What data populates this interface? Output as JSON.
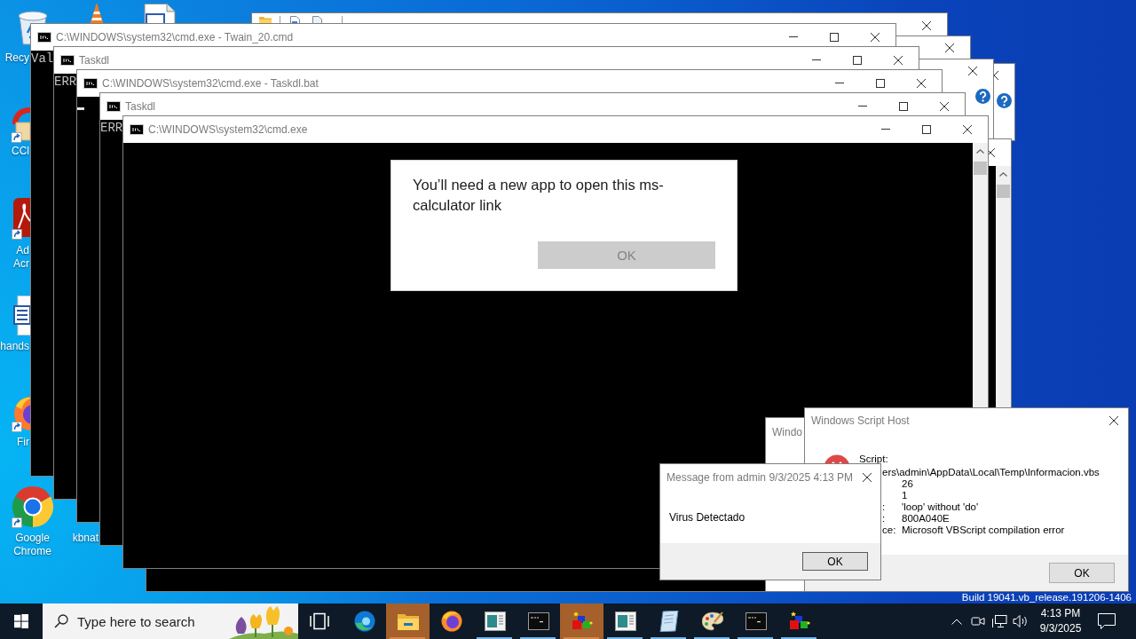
{
  "desktop": {
    "icons": [
      {
        "kind": "recycle_bin",
        "label": [
          "Recy"
        ]
      },
      {
        "kind": "cone"
      },
      {
        "kind": "document"
      },
      {
        "kind": "cleaner",
        "label": [
          "CCl"
        ]
      },
      {
        "kind": "pdf",
        "label": [
          "Ad",
          "Acr"
        ]
      },
      {
        "kind": "word_doc",
        "label": [
          "hands"
        ]
      },
      {
        "kind": "firefox",
        "label": [
          "Fir"
        ]
      },
      {
        "kind": "chrome",
        "label": [
          "Google",
          "Chrome"
        ]
      },
      {
        "label": [
          "kbnat"
        ]
      }
    ],
    "build_info": "Build 19041.vb_release.191206-1406"
  },
  "background_windows": [
    {
      "kind": "explorer"
    },
    {
      "kind": "window"
    },
    {
      "kind": "help_dialog"
    },
    {
      "kind": "help_dialog"
    },
    {
      "kind": "console"
    }
  ],
  "consoles": [
    {
      "title": "C:\\WINDOWS\\system32\\cmd.exe - Twain_20.cmd",
      "lines": [
        "Val"
      ],
      "cursor": false
    },
    {
      "title": "Taskdl",
      "lines": [
        "ERR"
      ],
      "cursor": false
    },
    {
      "title": "C:\\WINDOWS\\system32\\cmd.exe - Taskdl.bat",
      "cursor": true
    },
    {
      "title": "Taskdl",
      "lines": [
        "ERR"
      ],
      "cursor": false
    },
    {
      "title": "C:\\WINDOWS\\system32\\cmd.exe",
      "cursor": false
    }
  ],
  "app_prompt": {
    "message": "You’ll need a new app to open this ms-calculator link",
    "button": "OK",
    "disabled": true
  },
  "dialogs": [
    {
      "kind": "partial",
      "title": "Windo"
    },
    {
      "kind": "script_error",
      "title": "Windows Script Host",
      "script_label": "Script:",
      "script_path": "ers\\admin\\AppData\\Local\\Temp\\Informacion.vbs",
      "fields": [
        {
          "value": "26"
        },
        {
          "value": "1"
        },
        {
          "label": ":",
          "value": "'loop' without 'do'"
        },
        {
          "label": ":",
          "value": "800A040E"
        },
        {
          "label": "ce:",
          "value": "Microsoft VBScript compilation error"
        }
      ],
      "button": "OK"
    },
    {
      "kind": "message",
      "title": "Message from admin 9/3/2025 4:13 PM",
      "message": "Virus Detectado",
      "button": "OK"
    }
  ],
  "taskbar": {
    "search": {
      "placeholder": "Type here to search"
    },
    "apps": [
      {
        "kind": "edge",
        "running": false,
        "flashing": false
      },
      {
        "kind": "explorer",
        "running": true,
        "flashing": true
      },
      {
        "kind": "firefox",
        "running": false,
        "flashing": false
      },
      {
        "kind": "app_window",
        "running": true,
        "flashing": false
      },
      {
        "kind": "terminal",
        "running": true,
        "flashing": false
      },
      {
        "kind": "cubes",
        "running": true,
        "flashing": true
      },
      {
        "kind": "app_window",
        "running": true,
        "flashing": false
      },
      {
        "kind": "notepad",
        "running": true,
        "flashing": false
      },
      {
        "kind": "paint",
        "running": true,
        "flashing": false
      },
      {
        "kind": "terminal",
        "running": true,
        "flashing": false
      },
      {
        "kind": "cubes",
        "running": true,
        "flashing": false
      }
    ],
    "clock": {
      "time": "4:13 PM",
      "date": "9/3/2025"
    }
  }
}
